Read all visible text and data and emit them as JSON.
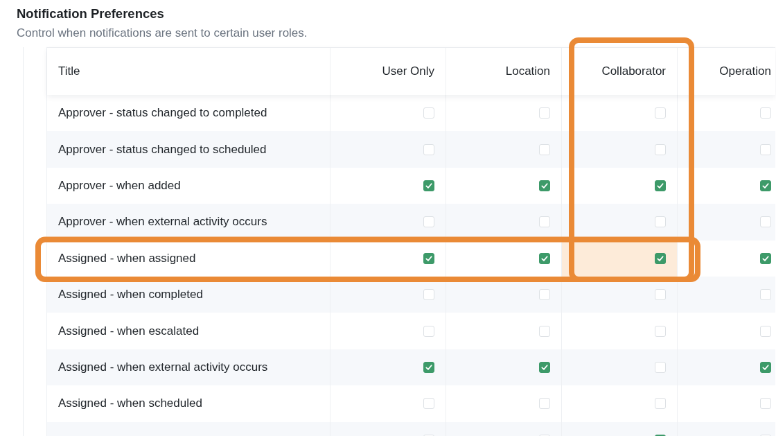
{
  "section": {
    "title": "Notification Preferences",
    "description": "Control when notifications are sent to certain user roles."
  },
  "table": {
    "columns": [
      {
        "label": "Title",
        "highlighted": false
      },
      {
        "label": "User Only",
        "highlighted": false
      },
      {
        "label": "Location",
        "highlighted": false
      },
      {
        "label": "Collaborator",
        "highlighted": true
      },
      {
        "label": "Operation",
        "highlighted": false
      }
    ],
    "rows": [
      {
        "title": "Approver - status changed to completed",
        "highlighted": false,
        "checks": [
          false,
          false,
          false,
          false
        ]
      },
      {
        "title": "Approver - status changed to scheduled",
        "highlighted": false,
        "checks": [
          false,
          false,
          false,
          false
        ]
      },
      {
        "title": "Approver - when added",
        "highlighted": false,
        "checks": [
          true,
          true,
          true,
          true
        ]
      },
      {
        "title": "Approver - when external activity occurs",
        "highlighted": false,
        "checks": [
          false,
          false,
          false,
          false
        ]
      },
      {
        "title": "Assigned - when assigned",
        "highlighted": true,
        "checks": [
          true,
          true,
          true,
          true
        ]
      },
      {
        "title": "Assigned - when completed",
        "highlighted": false,
        "checks": [
          false,
          false,
          false,
          false
        ]
      },
      {
        "title": "Assigned - when escalated",
        "highlighted": false,
        "checks": [
          false,
          false,
          false,
          false
        ]
      },
      {
        "title": "Assigned - when external activity occurs",
        "highlighted": false,
        "checks": [
          true,
          true,
          false,
          true
        ]
      },
      {
        "title": "Assigned - when scheduled",
        "highlighted": false,
        "checks": [
          false,
          false,
          false,
          false
        ]
      },
      {
        "highlighted": false,
        "checks": [
          false,
          false,
          true,
          false
        ]
      }
    ]
  }
}
